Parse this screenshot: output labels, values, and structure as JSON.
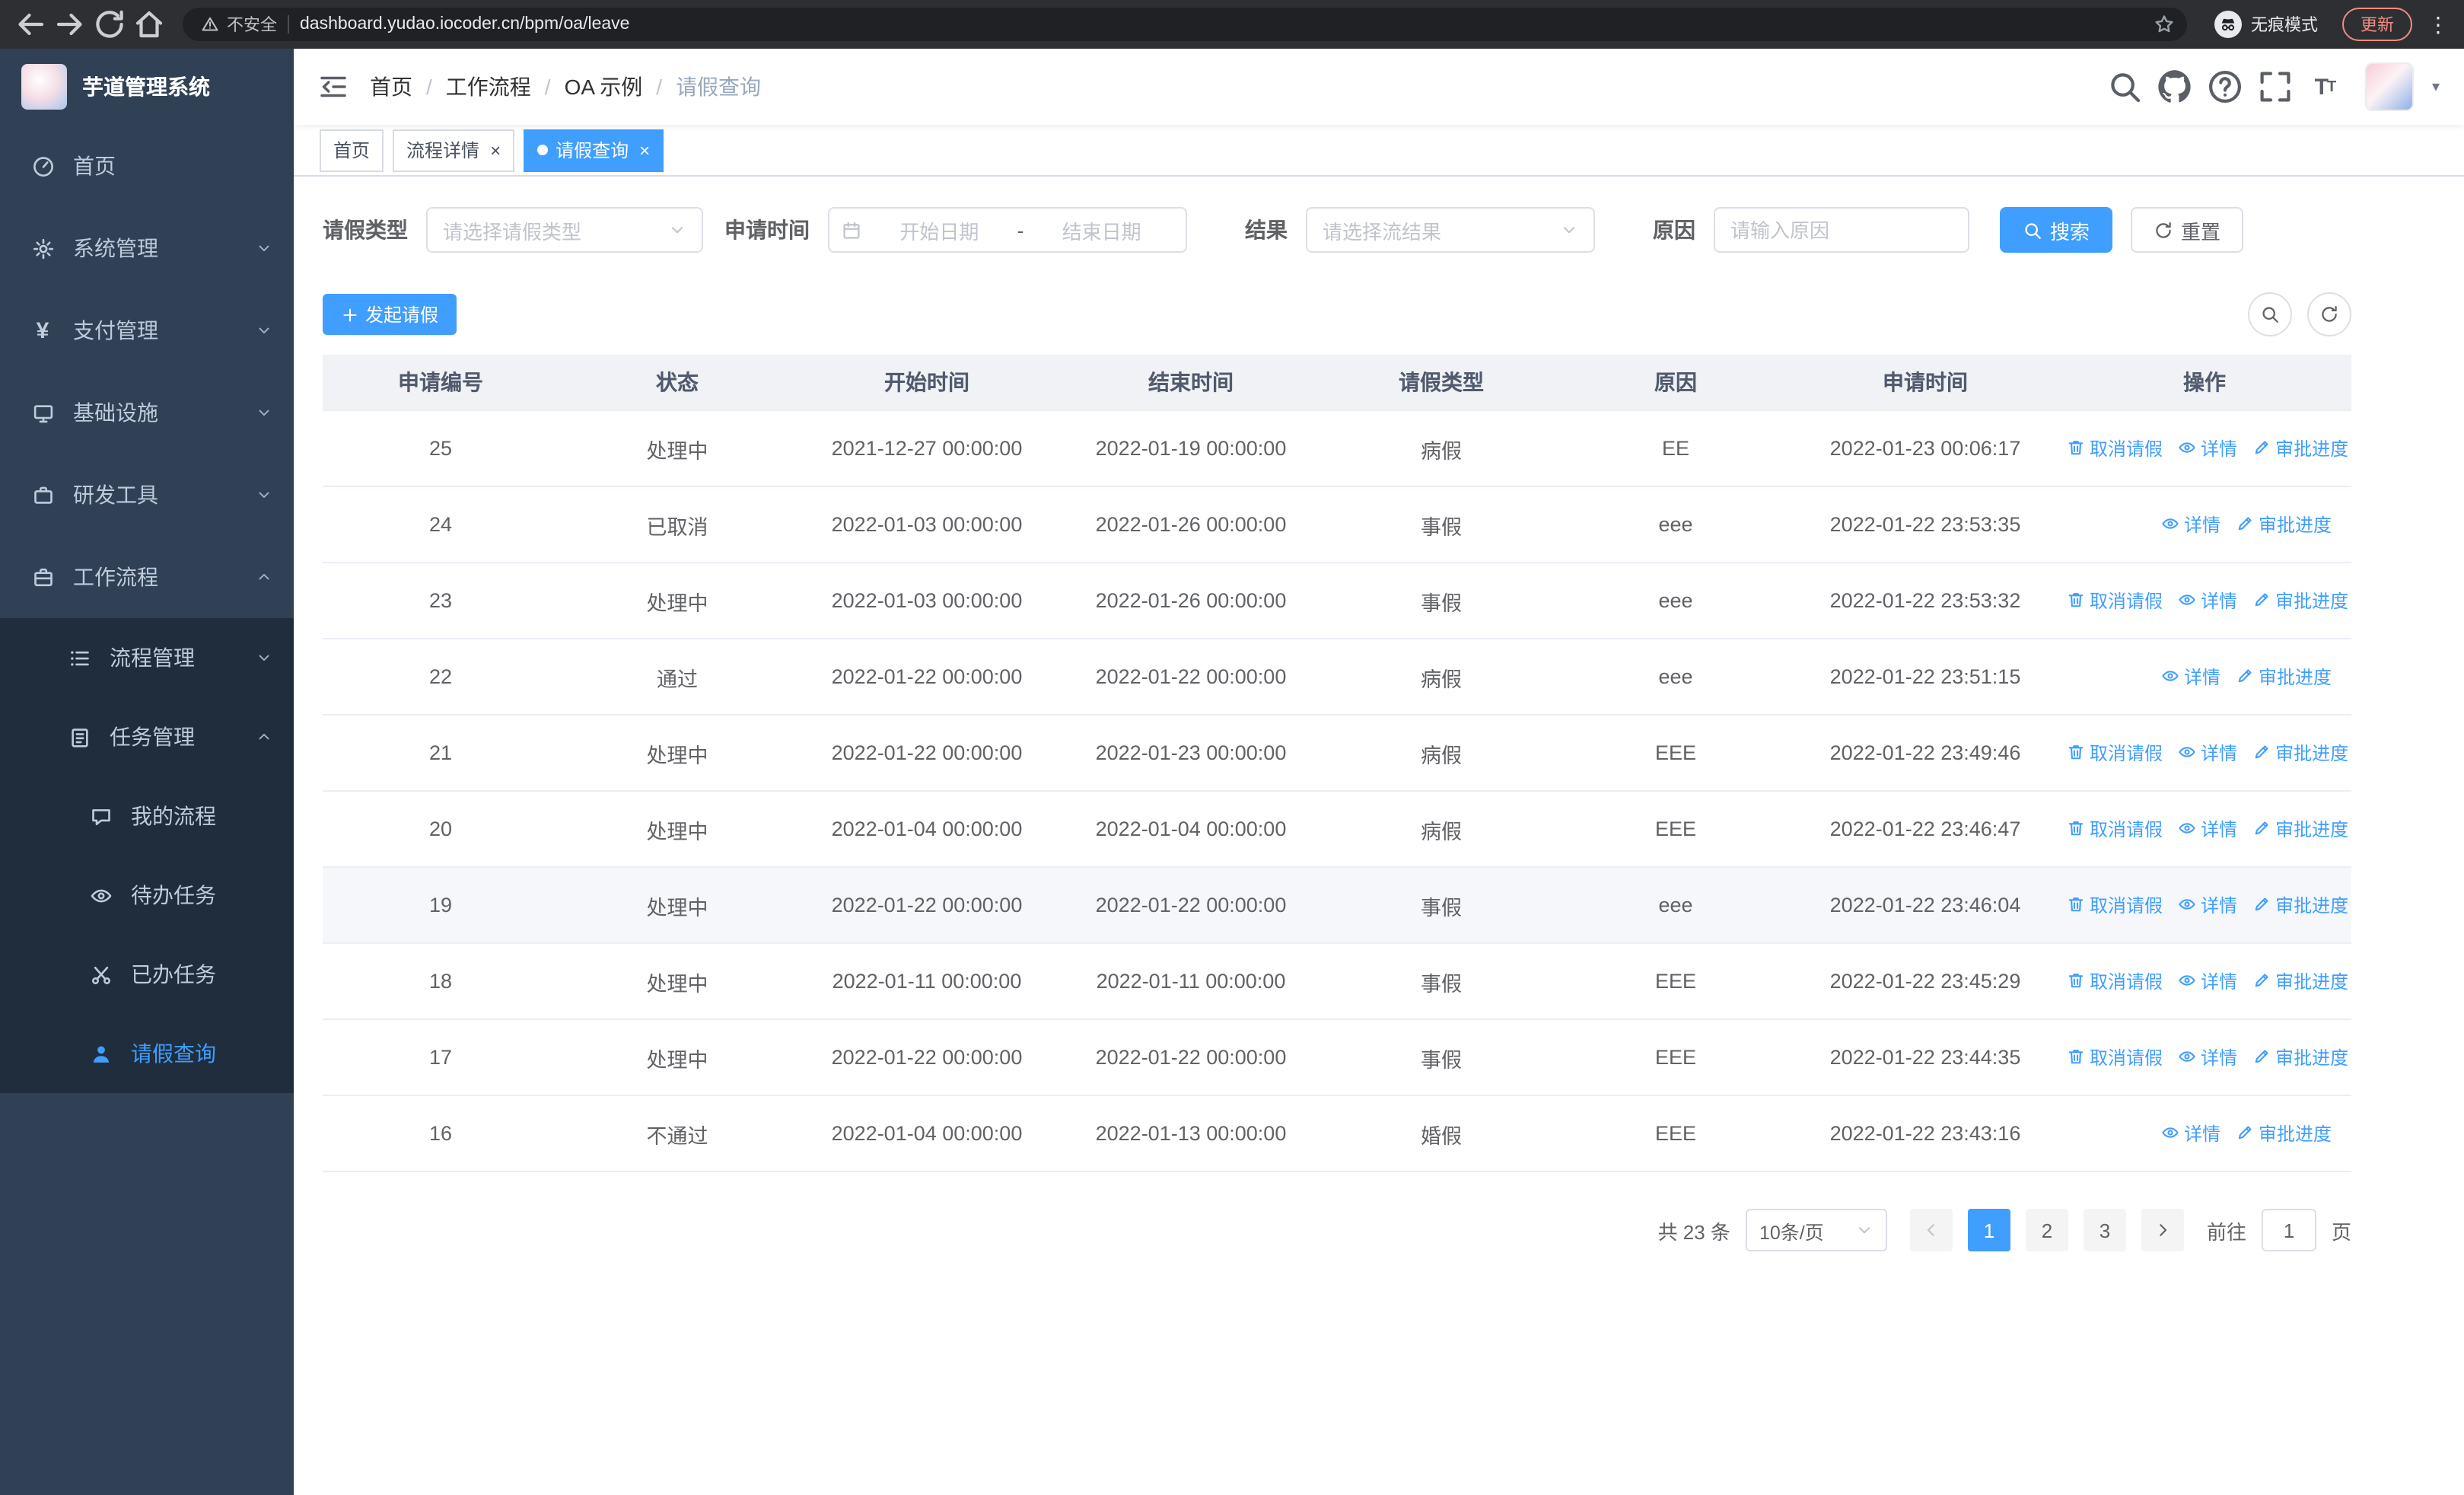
{
  "browser": {
    "security_label": "不安全",
    "url": "dashboard.yudao.iocoder.cn/bpm/oa/leave",
    "incognito_label": "无痕模式",
    "update_label": "更新"
  },
  "sidebar": {
    "app_title": "芋道管理系统",
    "menu": [
      {
        "label": "首页",
        "icon": "dashboard-icon"
      },
      {
        "label": "系统管理",
        "icon": "gear-icon",
        "expandable": true,
        "open": false
      },
      {
        "label": "支付管理",
        "icon": "yen-icon",
        "expandable": true,
        "open": false
      },
      {
        "label": "基础设施",
        "icon": "infrastructure-icon",
        "expandable": true,
        "open": false
      },
      {
        "label": "研发工具",
        "icon": "devtools-icon",
        "expandable": true,
        "open": false
      },
      {
        "label": "工作流程",
        "icon": "workflow-icon",
        "expandable": true,
        "open": true,
        "children": [
          {
            "label": "流程管理",
            "icon": "process-icon",
            "expandable": true,
            "open": false
          },
          {
            "label": "任务管理",
            "icon": "task-icon",
            "expandable": true,
            "open": true,
            "children": [
              {
                "label": "我的流程",
                "icon": "chat-icon"
              },
              {
                "label": "待办任务",
                "icon": "eye-icon"
              },
              {
                "label": "已办任务",
                "icon": "scissors-icon"
              },
              {
                "label": "请假查询",
                "icon": "user-icon",
                "active": true
              }
            ]
          }
        ]
      }
    ]
  },
  "navbar": {
    "breadcrumb": [
      "首页",
      "工作流程",
      "OA 示例",
      "请假查询"
    ]
  },
  "tabs": [
    {
      "label": "首页",
      "closable": false,
      "active": false
    },
    {
      "label": "流程详情",
      "closable": true,
      "active": false
    },
    {
      "label": "请假查询",
      "closable": true,
      "active": true
    }
  ],
  "filters": {
    "type_label": "请假类型",
    "type_placeholder": "请选择请假类型",
    "time_label": "申请时间",
    "start_placeholder": "开始日期",
    "range_separator": "-",
    "end_placeholder": "结束日期",
    "result_label": "结果",
    "result_placeholder": "请选择流结果",
    "reason_label": "原因",
    "reason_placeholder": "请输入原因",
    "search_label": "搜索",
    "reset_label": "重置"
  },
  "toolbar": {
    "create_label": "发起请假"
  },
  "table": {
    "columns": [
      "申请编号",
      "状态",
      "开始时间",
      "结束时间",
      "请假类型",
      "原因",
      "申请时间",
      "操作"
    ],
    "op_labels": {
      "cancel": "取消请假",
      "detail": "详情",
      "progress": "审批进度"
    },
    "rows": [
      {
        "id": "25",
        "status": "处理中",
        "start": "2021-12-27 00:00:00",
        "end": "2022-01-19 00:00:00",
        "type": "病假",
        "reason": "EE",
        "apply_time": "2022-01-23 00:06:17",
        "ops": [
          "cancel",
          "detail",
          "progress"
        ],
        "highlight": false
      },
      {
        "id": "24",
        "status": "已取消",
        "start": "2022-01-03 00:00:00",
        "end": "2022-01-26 00:00:00",
        "type": "事假",
        "reason": "eee",
        "apply_time": "2022-01-22 23:53:35",
        "ops": [
          "detail",
          "progress"
        ],
        "highlight": false
      },
      {
        "id": "23",
        "status": "处理中",
        "start": "2022-01-03 00:00:00",
        "end": "2022-01-26 00:00:00",
        "type": "事假",
        "reason": "eee",
        "apply_time": "2022-01-22 23:53:32",
        "ops": [
          "cancel",
          "detail",
          "progress"
        ],
        "highlight": false
      },
      {
        "id": "22",
        "status": "通过",
        "start": "2022-01-22 00:00:00",
        "end": "2022-01-22 00:00:00",
        "type": "病假",
        "reason": "eee",
        "apply_time": "2022-01-22 23:51:15",
        "ops": [
          "detail",
          "progress"
        ],
        "highlight": false
      },
      {
        "id": "21",
        "status": "处理中",
        "start": "2022-01-22 00:00:00",
        "end": "2022-01-23 00:00:00",
        "type": "病假",
        "reason": "EEE",
        "apply_time": "2022-01-22 23:49:46",
        "ops": [
          "cancel",
          "detail",
          "progress"
        ],
        "highlight": false
      },
      {
        "id": "20",
        "status": "处理中",
        "start": "2022-01-04 00:00:00",
        "end": "2022-01-04 00:00:00",
        "type": "病假",
        "reason": "EEE",
        "apply_time": "2022-01-22 23:46:47",
        "ops": [
          "cancel",
          "detail",
          "progress"
        ],
        "highlight": false
      },
      {
        "id": "19",
        "status": "处理中",
        "start": "2022-01-22 00:00:00",
        "end": "2022-01-22 00:00:00",
        "type": "事假",
        "reason": "eee",
        "apply_time": "2022-01-22 23:46:04",
        "ops": [
          "cancel",
          "detail",
          "progress"
        ],
        "highlight": true
      },
      {
        "id": "18",
        "status": "处理中",
        "start": "2022-01-11 00:00:00",
        "end": "2022-01-11 00:00:00",
        "type": "事假",
        "reason": "EEE",
        "apply_time": "2022-01-22 23:45:29",
        "ops": [
          "cancel",
          "detail",
          "progress"
        ],
        "highlight": false
      },
      {
        "id": "17",
        "status": "处理中",
        "start": "2022-01-22 00:00:00",
        "end": "2022-01-22 00:00:00",
        "type": "事假",
        "reason": "EEE",
        "apply_time": "2022-01-22 23:44:35",
        "ops": [
          "cancel",
          "detail",
          "progress"
        ],
        "highlight": false
      },
      {
        "id": "16",
        "status": "不通过",
        "start": "2022-01-04 00:00:00",
        "end": "2022-01-13 00:00:00",
        "type": "婚假",
        "reason": "EEE",
        "apply_time": "2022-01-22 23:43:16",
        "ops": [
          "detail",
          "progress"
        ],
        "highlight": false
      }
    ]
  },
  "pagination": {
    "total": "共 23 条",
    "page_size": "10条/页",
    "pages": [
      "1",
      "2",
      "3"
    ],
    "active_page": "1",
    "goto_label": "前往",
    "goto_value": "1",
    "page_unit": "页"
  },
  "colors": {
    "accent": "#409eff",
    "sidebar_bg": "#304156",
    "submenu_bg": "#1f2d3d"
  }
}
